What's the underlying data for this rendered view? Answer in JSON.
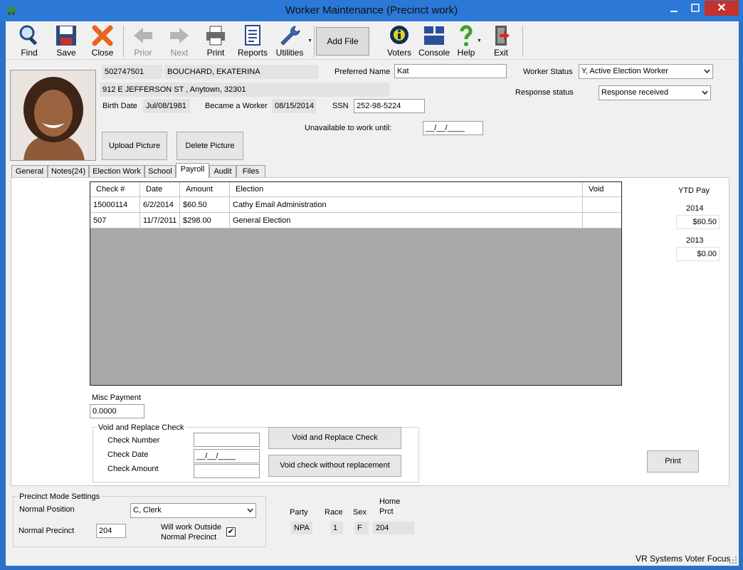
{
  "window": {
    "title": "Worker Maintenance (Precinct work)",
    "close_glyph": "✕"
  },
  "toolbar": {
    "find": "Find",
    "save": "Save",
    "close": "Close",
    "prior": "Prior",
    "next": "Next",
    "print": "Print",
    "reports": "Reports",
    "utilities": "Utilities",
    "add_file": "Add File",
    "voters": "Voters",
    "console": "Console",
    "help": "Help",
    "exit": "Exit"
  },
  "worker": {
    "id": "502747501",
    "name": "BOUCHARD, EKATERINA",
    "address": "912 E JEFFERSON ST , Anytown, 32301",
    "birth_date_label": "Birth Date",
    "birth_date": "Jul/08/1981",
    "became_worker_label": "Became a Worker",
    "became_worker": "08/15/2014",
    "ssn_label": "SSN",
    "ssn": "252-98-5224",
    "preferred_name_label": "Preferred Name",
    "preferred_name": "Kat",
    "worker_status_label": "Worker Status",
    "worker_status": "Y, Active Election Worker",
    "response_status_label": "Response status",
    "response_status": "Response received",
    "unavailable_label": "Unavailable to work until:",
    "unavailable_value": "__/__/____"
  },
  "picture": {
    "upload": "Upload Picture",
    "delete": "Delete Picture"
  },
  "tabs": [
    "General",
    "Notes(24)",
    "Election Work",
    "School",
    "Payroll",
    "Audit",
    "Files"
  ],
  "payroll": {
    "columns": [
      "Check #",
      "Date",
      "Amount",
      "Election",
      "Void"
    ],
    "rows": [
      {
        "check": "15000114",
        "date": "6/2/2014",
        "amount": "$60.50",
        "election": "Cathy Email Administration",
        "void": ""
      },
      {
        "check": "507",
        "date": "11/7/2011",
        "amount": "$298.00",
        "election": "General Election",
        "void": ""
      }
    ],
    "ytd_label": "YTD Pay",
    "ytd": [
      {
        "year": "2014",
        "amount": "$60.50"
      },
      {
        "year": "2013",
        "amount": "$0.00"
      }
    ],
    "misc_label": "Misc Payment",
    "misc_value": "0.0000",
    "void_group_title": "Void and Replace Check",
    "check_number_label": "Check Number",
    "check_date_label": "Check Date",
    "check_date_value": "__/__/____",
    "check_amount_label": "Check Amount",
    "void_replace_button": "Void and Replace Check",
    "void_only_button": "Void check without replacement",
    "print_button": "Print"
  },
  "precinct": {
    "group_title": "Precinct Mode Settings",
    "normal_position_label": "Normal Position",
    "normal_position": "C, Clerk",
    "normal_precinct_label": "Normal Precinct",
    "normal_precinct": "204",
    "outside_label_1": "Will work Outside",
    "outside_label_2": "Normal Precinct",
    "outside_checked": "✔",
    "party_label": "Party",
    "party": "NPA",
    "race_label": "Race",
    "race": "1",
    "sex_label": "Sex",
    "sex": "F",
    "home_prct_label_1": "Home",
    "home_prct_label_2": "Prct",
    "home_prct": "204"
  },
  "status_bar": {
    "text": "VR Systems Voter Focus"
  },
  "colors": {
    "titlebar": "#2c78d6",
    "close_button": "#c7312b",
    "grid_empty": "#a9a9a9"
  }
}
